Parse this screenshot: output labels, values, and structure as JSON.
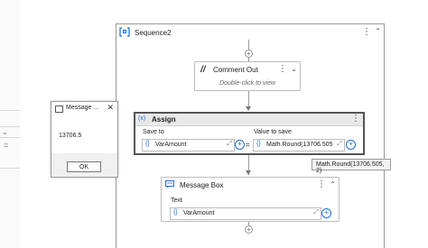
{
  "sequence": {
    "title": "Sequence2",
    "icon": "sequence-icon"
  },
  "comment_out": {
    "title": "Comment Out",
    "hint": "Double-click to view",
    "icon": "comment-out-icon"
  },
  "assign": {
    "title": "Assign",
    "save_to_label": "Save to",
    "value_label": "Value to save",
    "save_to_value": "VarAmount",
    "value_expression": "Math.Round(13706.505",
    "equals": "=",
    "icon": "assign-icon"
  },
  "tooltip": {
    "text": "Math.Round(13706.505, 2)"
  },
  "message_box": {
    "title": "Message Box",
    "text_label": "Text",
    "text_value": "VarAmount",
    "icon": "message-box-icon"
  },
  "dialog": {
    "title": "Message ...",
    "message": "13706.5",
    "ok_label": "OK"
  },
  "colors": {
    "accent": "#1e6fd0",
    "border": "#9a9a9a",
    "selected_border": "#555555"
  }
}
